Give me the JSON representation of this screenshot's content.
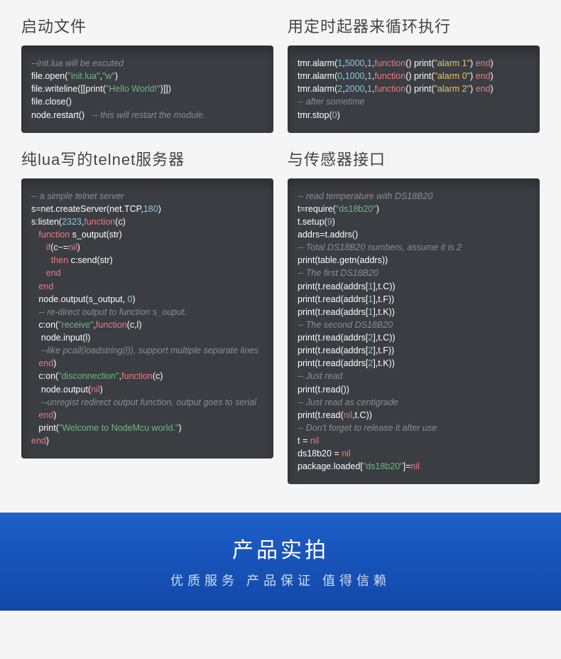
{
  "headings": {
    "h1": "启动文件",
    "h2": "用定时起器来循环执行",
    "h3": "纯lua写的telnet服务器",
    "h4": "与传感器接口"
  },
  "block1": {
    "c1": "--init.lua will be excuted",
    "l2a": "file.open(",
    "l2s1": "\"init.lua\"",
    "l2c": ",",
    "l2s2": "\"w\"",
    "l2b": ")",
    "l3a": "file.writeline([[print(",
    "l3s": "\"Hello World!\"",
    "l3b": ")]])",
    "l4": "file.close()",
    "l5a": "node.restart()   ",
    "l5c": "-- this will restart the module."
  },
  "block2": {
    "l1a": "tmr.alarm(",
    "l1n1": "1",
    "l1c1": ",",
    "l1n2": "5000",
    "l1c2": ",",
    "l1n3": "1",
    "l1c3": ",",
    "l1k": "function",
    "l1b": "() print(",
    "l1s": "\"alarm 1\"",
    "l1d": ") ",
    "l1e": "end",
    "l1f": ")",
    "l2a": "tmr.alarm(",
    "l2n1": "0",
    "l2c1": ",",
    "l2n2": "1000",
    "l2c2": ",",
    "l2n3": "1",
    "l2c3": ",",
    "l2k": "function",
    "l2b": "() print(",
    "l2s": "\"alarm 0\"",
    "l2d": ") ",
    "l2e": "end",
    "l2f": ")",
    "l3a": "tmr.alarm(",
    "l3n1": "2",
    "l3c1": ",",
    "l3n2": "2000",
    "l3c2": ",",
    "l3n3": "1",
    "l3c3": ",",
    "l3k": "function",
    "l3b": "() print(",
    "l3s": "\"alarm 2\"",
    "l3d": ") ",
    "l3e": "end",
    "l3f": ")",
    "c4": "-- after sometime",
    "l5a": "tmr.stop(",
    "l5n": "0",
    "l5b": ")"
  },
  "block3": {
    "c1": "-- a simple telnet server",
    "l2a": "s=net.createServer(net.TCP,",
    "l2n": "180",
    "l2b": ")",
    "l3a": "s:listen(",
    "l3n": "2323",
    "l3b": ",",
    "l3k": "function",
    "l3c": "(c)",
    "l4a": "   ",
    "l4k": "function",
    "l4b": " s_output(str)",
    "l5a": "      ",
    "l5k": "if",
    "l5b": "(c~=",
    "l5k2": "nil",
    "l5c": ")",
    "l6a": "        ",
    "l6k": "then",
    "l6b": " c:send(str)",
    "l7a": "      ",
    "l7k": "end",
    "l8a": "   ",
    "l8k": "end",
    "l9a": "   node.output(s_output, ",
    "l9n": "0",
    "l9b": ")",
    "c10": "   -- re-direct output to function s_ouput.",
    "l11a": "   c:on(",
    "l11s": "\"receive\"",
    "l11b": ",",
    "l11k": "function",
    "l11c": "(c,l)",
    "l12": "    node.input(l)",
    "c13": "    --like pcall(loadstring(l)), support multiple separate lines",
    "l14a": "   ",
    "l14k": "end",
    "l14b": ")",
    "l15a": "   c:on(",
    "l15s": "\"disconnection\"",
    "l15b": ",",
    "l15k": "function",
    "l15c": "(c)",
    "l16a": "    node.output(",
    "l16k": "nil",
    "l16b": ")",
    "c17": "    --unregist redirect output function, output goes to serial",
    "l18a": "   ",
    "l18k": "end",
    "l18b": ")",
    "l19a": "   print(",
    "l19s": "\"Welcome to NodeMcu world.\"",
    "l19b": ")",
    "l20a": "",
    "l20k": "end",
    "l20b": ")"
  },
  "block4": {
    "c1": "-- read temperature with DS18B20",
    "l2a": "t=require(",
    "l2s": "\"ds18b20\"",
    "l2b": ")",
    "l3a": "t.setup(",
    "l3n": "9",
    "l3b": ")",
    "l4": "addrs=t.addrs()",
    "c5": "-- Total DS18B20 numbers, assume it is 2",
    "l6": "print(table.getn(addrs))",
    "c7": "-- The first DS18B20",
    "l8a": "print(t.read(addrs[",
    "l8n": "1",
    "l8b": "],t.C))",
    "l9a": "print(t.read(addrs[",
    "l9n": "1",
    "l9b": "],t.F))",
    "l10a": "print(t.read(addrs[",
    "l10n": "1",
    "l10b": "],t.K))",
    "c11": "-- The second DS18B20",
    "l12a": "print(t.read(addrs[",
    "l12n": "2",
    "l12b": "],t.C))",
    "l13a": "print(t.read(addrs[",
    "l13n": "2",
    "l13b": "],t.F))",
    "l14a": "print(t.read(addrs[",
    "l14n": "2",
    "l14b": "],t.K))",
    "c15": "-- Just read",
    "l16": "print(t.read())",
    "c17": "-- Just read as centigrade",
    "l18a": "print(t.read(",
    "l18k": "nil",
    "l18b": ",t.C))",
    "c19": "-- Don't forget to release it after use",
    "l20a": "t = ",
    "l20k": "nil",
    "l21a": "ds18b20 = ",
    "l21k": "nil",
    "l22a": "package.loaded[",
    "l22s": "\"ds18b20\"",
    "l22b": "]=",
    "l22k": "nil"
  },
  "banner": {
    "title": "产品实拍",
    "subtitle": "优质服务 产品保证 值得信赖"
  }
}
